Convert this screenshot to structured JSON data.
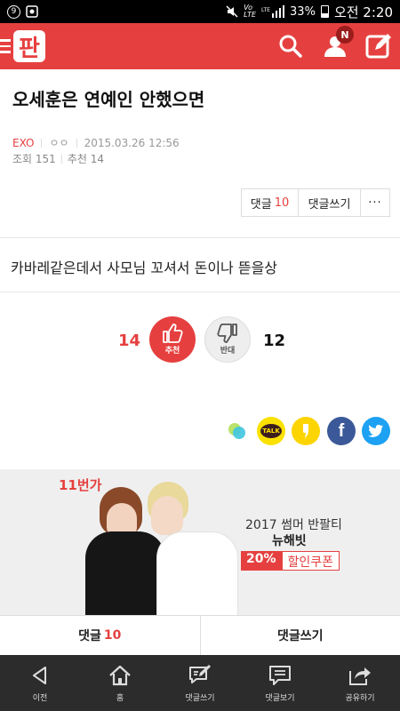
{
  "status_bar": {
    "left_badge": "9",
    "net_label": "Vo\nLTE",
    "battery": "33%",
    "time": "오전 2:20"
  },
  "app": {
    "logo_text": "판",
    "notification_badge": "N"
  },
  "article": {
    "title": "오세훈은 연예인 안했으면",
    "category": "EXO",
    "author": "ㅇㅇ",
    "date": "2015.03.26 12:56",
    "views_label": "조회 151",
    "recommend_label": "추천 14",
    "body": "카바레같은데서 사모님 꼬셔서 돈이나 뜯을상"
  },
  "actions": {
    "comment_label": "댓글",
    "comment_count": "10",
    "write_label": "댓글쓰기",
    "more_label": "···"
  },
  "vote": {
    "up_count": "14",
    "up_label": "추천",
    "down_count": "12",
    "down_label": "반대"
  },
  "share": {
    "kakao_label": "TALK",
    "facebook_label": "f"
  },
  "ad": {
    "brand": "11번가",
    "line1": "2017 썸머 반팔티",
    "line2": "뉴해빗",
    "coupon_pct": "20%",
    "coupon_text": "할인쿠폰"
  },
  "comment_bar": {
    "comment_label": "댓글",
    "comment_count": "10",
    "write_label": "댓글쓰기"
  },
  "nav": [
    {
      "label": "이전",
      "icon": "back-icon"
    },
    {
      "label": "홈",
      "icon": "home-icon"
    },
    {
      "label": "댓글쓰기",
      "icon": "compose-icon"
    },
    {
      "label": "댓글보기",
      "icon": "chat-icon"
    },
    {
      "label": "공유하기",
      "icon": "share-icon"
    }
  ],
  "colors": {
    "accent": "#e5403f",
    "nav_bg": "#2c2c2c"
  }
}
